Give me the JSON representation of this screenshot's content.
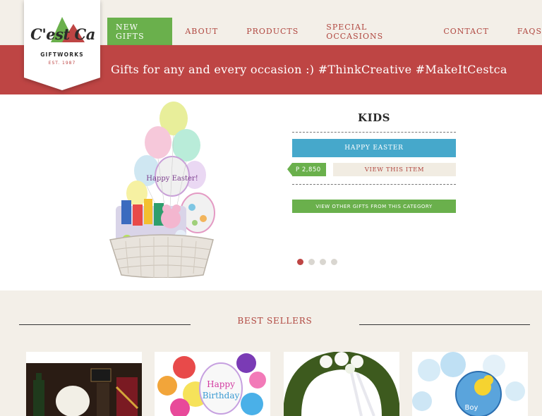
{
  "brand": {
    "logo_script": "C'est Ca",
    "logo_sub": "GIFTWORKS",
    "logo_est": "EST. 1987"
  },
  "nav": {
    "items": [
      {
        "label": "NEW GIFTS",
        "active": true
      },
      {
        "label": "ABOUT",
        "active": false
      },
      {
        "label": "PRODUCTS",
        "active": false
      },
      {
        "label": "SPECIAL OCCASIONS",
        "active": false
      },
      {
        "label": "CONTACT",
        "active": false
      },
      {
        "label": "FAQS",
        "active": false
      }
    ]
  },
  "banner": {
    "tagline": "Gifts for any and every occasion :) #ThinkCreative #MakeItCestca"
  },
  "hero": {
    "category_title": "KIDS",
    "product_name": "HAPPY EASTER",
    "price": "P 2,850",
    "view_item_label": "VIEW THIS ITEM",
    "category_button_label": "VIEW OTHER GIFTS FROM THIS CATEGORY",
    "slides_total": 4,
    "active_slide": 1
  },
  "best_sellers": {
    "title": "BEST SELLERS",
    "items": [
      {
        "icon": "wine-gift-set-thumbnail"
      },
      {
        "icon": "birthday-balloons-thumbnail"
      },
      {
        "icon": "funeral-wreath-thumbnail"
      },
      {
        "icon": "baby-boy-balloons-thumbnail"
      }
    ]
  },
  "colors": {
    "brand_red": "#be4544",
    "accent_green": "#6ab04c",
    "accent_blue": "#46a8cb",
    "background": "#f3efe8"
  }
}
